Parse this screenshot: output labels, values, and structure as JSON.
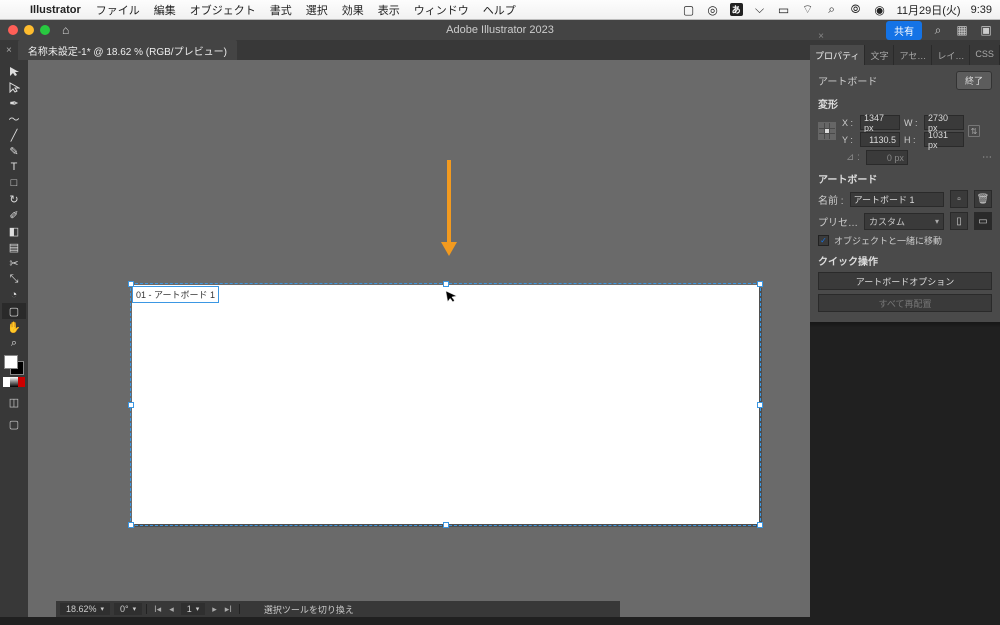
{
  "menubar": {
    "app": "Illustrator",
    "items": [
      "ファイル",
      "編集",
      "オブジェクト",
      "書式",
      "選択",
      "効果",
      "表示",
      "ウィンドウ",
      "ヘルプ"
    ],
    "date": "11月29日(火)",
    "time": "9:39",
    "lang_badge": "あ"
  },
  "titlebar": {
    "title": "Adobe Illustrator 2023",
    "share": "共有"
  },
  "doctab": {
    "label": "名称未設定-1* @ 18.62 % (RGB/プレビュー)"
  },
  "artboard": {
    "label": "01 - アートボード 1"
  },
  "properties": {
    "tabs": [
      "プロパティ",
      "文字",
      "アセ…",
      "レイ…",
      "CSS"
    ],
    "section_top": "アートボード",
    "end_btn": "終了",
    "transform_h": "変形",
    "x_lbl": "X :",
    "y_lbl": "Y :",
    "w_lbl": "W :",
    "h_lbl": "H :",
    "x": "1347 px",
    "y": "1130.5",
    "w": "2730 px",
    "h": "1031 px",
    "angle_lbl": "⊿ :",
    "angle": "0 px",
    "artboard_h": "アートボード",
    "name_lbl": "名前 :",
    "name_val": "アートボード 1",
    "preset_lbl": "プリセ…",
    "preset_val": "カスタム",
    "move_with_obj": "オブジェクトと一緒に移動",
    "quick_h": "クイック操作",
    "ab_options": "アートボードオプション",
    "rearrange": "すべて再配置"
  },
  "status": {
    "zoom": "18.62%",
    "rotate": "0°",
    "page": "1",
    "info": "選択ツールを切り換え"
  }
}
